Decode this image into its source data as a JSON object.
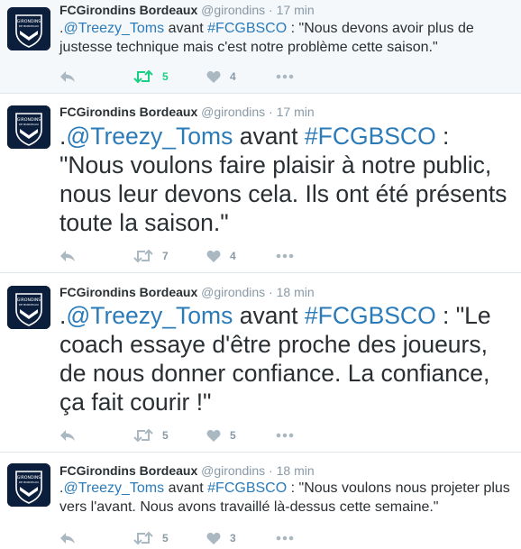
{
  "colors": {
    "link": "#2b7bb9",
    "retweet_active": "#19cf86",
    "meta_gray": "#8899a6",
    "avatar_bg": "#0b1f3d"
  },
  "tweets": [
    {
      "fullname": "FCGirondins Bordeaux",
      "handle": "@girondins",
      "dot": "·",
      "time": "17 min",
      "text": {
        "prefix": ".",
        "mention": "@Treezy_Toms",
        "mid": " avant ",
        "hashtag": "#FCGBSCO",
        "rest": " : \"Nous devons avoir plus de justesse technique mais c'est notre problème cette saison.\""
      },
      "retweets": "5",
      "likes": "4",
      "retweeted": true
    },
    {
      "fullname": "FCGirondins Bordeaux",
      "handle": "@girondins",
      "dot": "·",
      "time": "17 min",
      "text": {
        "prefix": ".",
        "mention": "@Treezy_Toms",
        "mid": " avant ",
        "hashtag": "#FCGBSCO",
        "rest": " : \"Nous voulons faire plaisir à notre public, nous leur devons cela. Ils ont été présents toute la saison.\""
      },
      "retweets": "7",
      "likes": "4",
      "retweeted": false
    },
    {
      "fullname": "FCGirondins Bordeaux",
      "handle": "@girondins",
      "dot": "·",
      "time": "18 min",
      "text": {
        "prefix": ".",
        "mention": "@Treezy_Toms",
        "mid": " avant ",
        "hashtag": "#FCGBSCO",
        "rest": " : \"Le coach essaye d'être proche des joueurs, de nous donner confiance. La confiance, ça fait courir !\""
      },
      "retweets": "5",
      "likes": "5",
      "retweeted": false
    },
    {
      "fullname": "FCGirondins Bordeaux",
      "handle": "@girondins",
      "dot": "·",
      "time": "18 min",
      "text": {
        "prefix": ".",
        "mention": "@Treezy_Toms",
        "mid": " avant ",
        "hashtag": "#FCGBSCO",
        "rest": " : \"Nous voulons nous projeter plus vers l'avant. Nous avons travaillé là-dessus cette semaine.\""
      },
      "retweets": "5",
      "likes": "3",
      "retweeted": false
    }
  ],
  "icons": {
    "reply": "reply-icon",
    "retweet": "retweet-icon",
    "like": "heart-icon",
    "more": "more-icon",
    "avatar": "girondins-crest-logo"
  },
  "logo_text": {
    "top": "GIRONDINS",
    "bottom": "DE BORDEAUX"
  }
}
